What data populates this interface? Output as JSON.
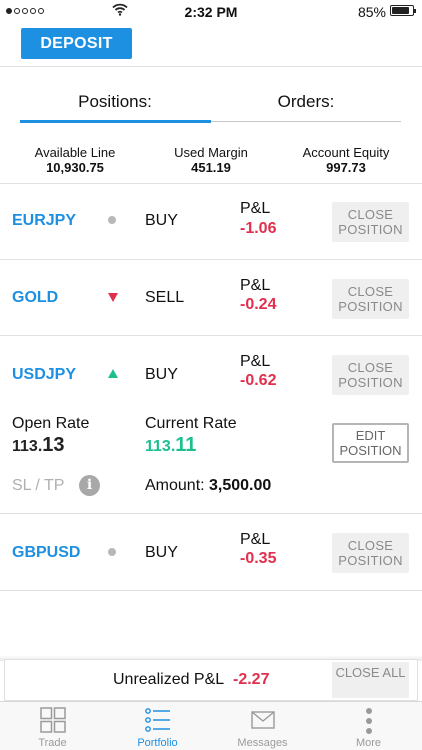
{
  "status_bar": {
    "time": "2:32 PM",
    "battery_percent": "85%",
    "battery_level": 0.85,
    "signal_bars_filled": 1,
    "signal_bars_total": 5
  },
  "header": {
    "deposit_label": "DEPOSIT"
  },
  "tabs": [
    {
      "label": "Positions:",
      "active": true
    },
    {
      "label": "Orders:",
      "active": false
    }
  ],
  "account": {
    "available_line_label": "Available Line",
    "available_line_value": "10,930.75",
    "used_margin_label": "Used Margin",
    "used_margin_value": "451.19",
    "equity_label": "Account Equity",
    "equity_value": "997.73"
  },
  "pl_label": "P&L",
  "close_position_label": "CLOSE POSITION",
  "positions": [
    {
      "symbol": "EURJPY",
      "trend": "neutral",
      "side": "BUY",
      "pl": "-1.06"
    },
    {
      "symbol": "GOLD",
      "trend": "down",
      "side": "SELL",
      "pl": "-0.24"
    },
    {
      "symbol": "USDJPY",
      "trend": "up",
      "side": "BUY",
      "pl": "-0.62",
      "details": {
        "open_rate_label": "Open Rate",
        "open_rate_main": "113.",
        "open_rate_big": "13",
        "current_rate_label": "Current Rate",
        "current_rate_main": "113.",
        "current_rate_big": "11",
        "edit_label": "EDIT POSITION",
        "sltp_label": "SL / TP",
        "amount_label": "Amount:",
        "amount_value": "3,500.00"
      }
    },
    {
      "symbol": "GBPUSD",
      "trend": "neutral",
      "side": "BUY",
      "pl": "-0.35"
    }
  ],
  "footer": {
    "unrealized_label": "Unrealized P&L",
    "unrealized_value": "-2.27",
    "close_all_label": "CLOSE ALL"
  },
  "nav": [
    {
      "label": "Trade",
      "icon": "grid-icon"
    },
    {
      "label": "Portfolio",
      "icon": "list-icon",
      "active": true
    },
    {
      "label": "Messages",
      "icon": "envelope-icon"
    },
    {
      "label": "More",
      "icon": "more-icon"
    }
  ],
  "colors": {
    "accent": "#1e90e2",
    "negative": "#e0304e",
    "positive": "#1dbf8f"
  }
}
